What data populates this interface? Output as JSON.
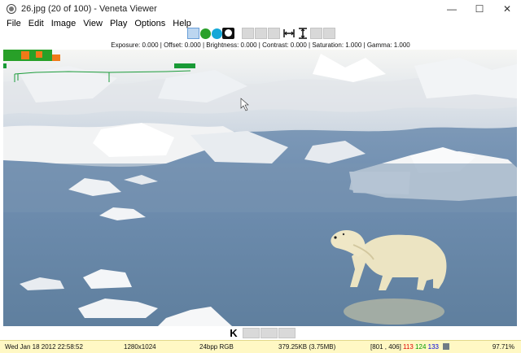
{
  "window": {
    "title": "26.jpg (20 of 100) - Veneta Viewer",
    "app_icon": "viewer-icon",
    "minimize": "—",
    "maximize": "☐",
    "close": "✕"
  },
  "menu": [
    "File",
    "Edit",
    "Image",
    "View",
    "Play",
    "Options",
    "Help"
  ],
  "toolbar": {
    "items": [
      {
        "name": "mode-tile-button",
        "icon": "tile-icon",
        "active": true
      },
      {
        "name": "green-channel-button",
        "color": "#2aa02a"
      },
      {
        "name": "cyan-channel-button",
        "color": "#15a8d8"
      },
      {
        "name": "mono-channel-button",
        "color": "#111111"
      },
      {
        "name": "blank-button-1"
      },
      {
        "name": "blank-button-2"
      },
      {
        "name": "blank-button-3"
      },
      {
        "name": "fit-width-button",
        "icon": "fit-width-icon",
        "glyph": "⟼"
      },
      {
        "name": "fit-height-button",
        "icon": "fit-height-icon",
        "glyph": "I"
      },
      {
        "name": "blank-button-4"
      },
      {
        "name": "blank-button-5"
      }
    ]
  },
  "adjustments": {
    "exposure": "Exposure: 0.000",
    "offset": "Offset: 0.000",
    "brightness": "Brightness: 0.000",
    "contrast": "Contrast: 0.000",
    "saturation": "Saturation: 1.000",
    "gamma": "Gamma: 1.000",
    "separator": "|"
  },
  "nav": {
    "first_glyph": "K",
    "first_icon": "first-image-icon"
  },
  "status": {
    "datetime": "Wed Jan 18 2012 22:58:52",
    "dimensions": "1280x1024",
    "format": "24bpp RGB",
    "filesize": "379.25KB (3.75MB)",
    "coords": "[801 , 406]",
    "r": "113",
    "g": "124",
    "b": "133",
    "swatch_color": "#717c85",
    "zoom": "97.71%"
  },
  "colors": {
    "red_value": "#e00000",
    "green_value": "#009900",
    "blue_value": "#0000dd",
    "statusbar_bg": "#fff8c4"
  },
  "image": {
    "subject": "polar bear on sea ice",
    "overlay": "histogram-overlay"
  }
}
